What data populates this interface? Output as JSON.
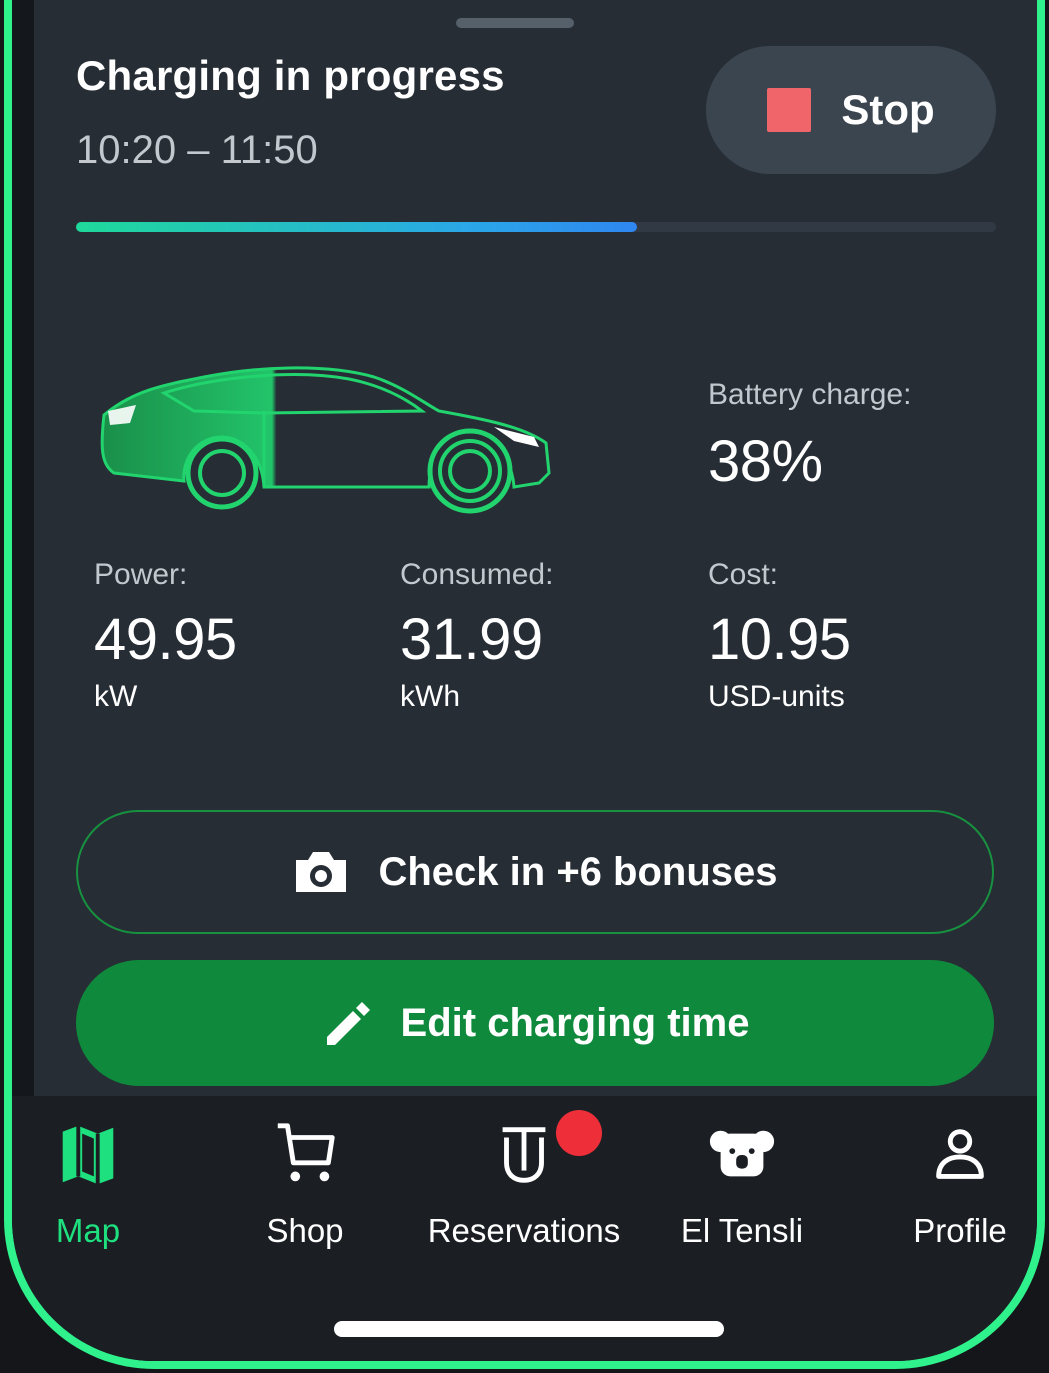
{
  "header": {
    "title": "Charging in progress",
    "time_range": "10:20 – 11:50",
    "stop_label": "Stop"
  },
  "progress": {
    "fraction": 0.61
  },
  "battery": {
    "label": "Battery charge:",
    "value": "38%"
  },
  "stats": {
    "power": {
      "label": "Power:",
      "value": "49.95",
      "unit": "kW"
    },
    "consumed": {
      "label": "Consumed:",
      "value": "31.99",
      "unit": "kWh"
    },
    "cost": {
      "label": "Cost:",
      "value": "10.95",
      "unit": "USD-units"
    }
  },
  "actions": {
    "checkin_label": "Check in +6 bonuses",
    "edit_label": "Edit charging time"
  },
  "nav": {
    "items": [
      {
        "label": "Map",
        "icon": "map-icon",
        "active": true
      },
      {
        "label": "Shop",
        "icon": "cart-icon",
        "active": false
      },
      {
        "label": "Reservations",
        "icon": "reservations-icon",
        "active": false,
        "badge": true
      },
      {
        "label": "El Tensli",
        "icon": "koala-icon",
        "active": false
      },
      {
        "label": "Profile",
        "icon": "profile-icon",
        "active": false
      }
    ]
  },
  "colors": {
    "accent": "#2ff28c",
    "primary_button": "#0f8a3c",
    "stop": "#f0656a",
    "badge": "#ee2f3a",
    "active_nav": "#1fe07f"
  }
}
